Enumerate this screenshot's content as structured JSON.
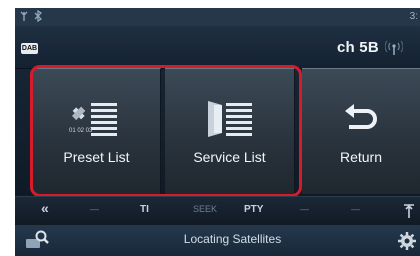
{
  "statusbar": {
    "clock": "3:"
  },
  "header": {
    "source_badge": "DAB",
    "channel": "ch 5B"
  },
  "buttons": {
    "preset": {
      "label": "Preset List",
      "mini_text": "01 02 03"
    },
    "service": {
      "label": "Service List"
    },
    "return": {
      "label": "Return"
    }
  },
  "funcbar": {
    "back": "«",
    "k1": "—",
    "k2": "TI",
    "k3": "SEEK",
    "k4": "PTY",
    "k5": "—",
    "k6": "—"
  },
  "bottombar": {
    "status": "Locating Satellites"
  },
  "colors": {
    "highlight": "#d81b2a",
    "screen_bg": "#13202d"
  }
}
